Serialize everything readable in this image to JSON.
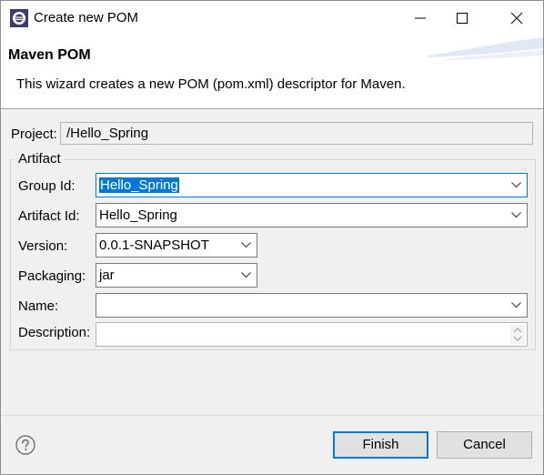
{
  "window": {
    "title": "Create new POM",
    "app_icon": "eclipse-icon"
  },
  "header": {
    "title": "Maven POM",
    "description": "This wizard creates a new POM (pom.xml) descriptor for Maven."
  },
  "project": {
    "label": "Project:",
    "value": "/Hello_Spring"
  },
  "artifact": {
    "group_title": "Artifact",
    "group_id": {
      "label": "Group Id:",
      "value": "Hello_Spring"
    },
    "artifact_id": {
      "label": "Artifact Id:",
      "value": "Hello_Spring"
    },
    "version": {
      "label": "Version:",
      "value": "0.0.1-SNAPSHOT"
    },
    "packaging": {
      "label": "Packaging:",
      "value": "jar"
    },
    "name": {
      "label": "Name:",
      "value": ""
    },
    "description": {
      "label": "Description:",
      "value": ""
    }
  },
  "buttons": {
    "finish": "Finish",
    "cancel": "Cancel"
  },
  "colors": {
    "selection": "#0078d7",
    "background": "#f0f0f0"
  }
}
